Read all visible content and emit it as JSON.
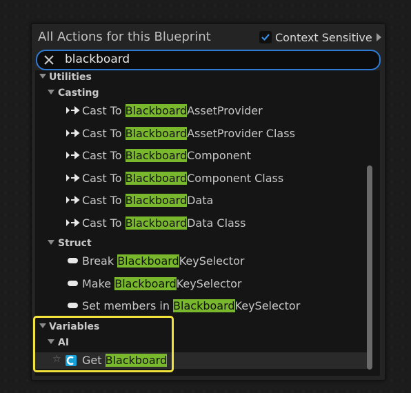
{
  "panel": {
    "title": "All Actions for this Blueprint",
    "context_sensitive_label": "Context Sensitive",
    "context_sensitive_checked": true
  },
  "search": {
    "value": "blackboard"
  },
  "highlight_color": "#79b82c",
  "selection_outline_color": "#f2e23c",
  "tree": {
    "utilities": "Utilities",
    "casting": "Casting",
    "cast_items": [
      {
        "pre": "Cast To ",
        "match": "Blackboard",
        "post": "AssetProvider"
      },
      {
        "pre": "Cast To ",
        "match": "Blackboard",
        "post": "AssetProvider Class"
      },
      {
        "pre": "Cast To ",
        "match": "Blackboard",
        "post": "Component"
      },
      {
        "pre": "Cast To ",
        "match": "Blackboard",
        "post": "Component Class"
      },
      {
        "pre": "Cast To ",
        "match": "Blackboard",
        "post": "Data"
      },
      {
        "pre": "Cast To ",
        "match": "Blackboard",
        "post": "Data Class"
      }
    ],
    "struct": "Struct",
    "struct_items": [
      {
        "pre": "Break ",
        "match": "Blackboard",
        "post": "KeySelector"
      },
      {
        "pre": "Make ",
        "match": "Blackboard",
        "post": "KeySelector"
      },
      {
        "pre": "Set members in ",
        "match": "Blackboard",
        "post": "KeySelector"
      }
    ],
    "variables": "Variables",
    "ai": "AI",
    "ai_items": [
      {
        "pre": "Get ",
        "match": "Blackboard",
        "post": ""
      }
    ]
  }
}
